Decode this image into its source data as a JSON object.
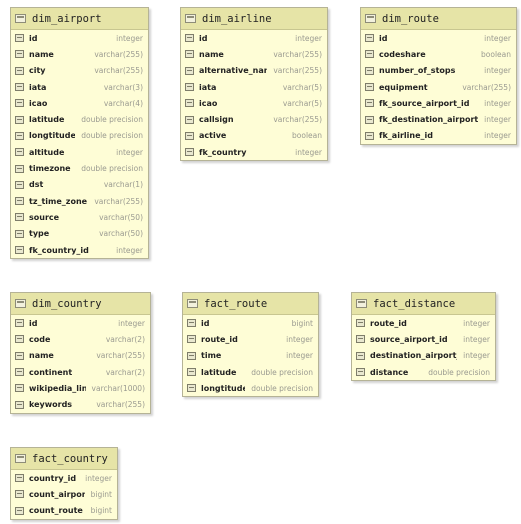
{
  "tables": [
    {
      "id": "dim-airport",
      "name": "dim_airport",
      "columns": [
        {
          "name": "id",
          "type": "integer"
        },
        {
          "name": "name",
          "type": "varchar(255)"
        },
        {
          "name": "city",
          "type": "varchar(255)"
        },
        {
          "name": "iata",
          "type": "varchar(3)"
        },
        {
          "name": "icao",
          "type": "varchar(4)"
        },
        {
          "name": "latitude",
          "type": "double precision"
        },
        {
          "name": "longtitude",
          "type": "double precision"
        },
        {
          "name": "altitude",
          "type": "integer"
        },
        {
          "name": "timezone",
          "type": "double precision"
        },
        {
          "name": "dst",
          "type": "varchar(1)"
        },
        {
          "name": "tz_time_zone",
          "type": "varchar(255)"
        },
        {
          "name": "source",
          "type": "varchar(50)"
        },
        {
          "name": "type",
          "type": "varchar(50)"
        },
        {
          "name": "fk_country_id",
          "type": "integer"
        }
      ]
    },
    {
      "id": "dim-airline",
      "name": "dim_airline",
      "columns": [
        {
          "name": "id",
          "type": "integer"
        },
        {
          "name": "name",
          "type": "varchar(255)"
        },
        {
          "name": "alternative_name",
          "type": "varchar(255)"
        },
        {
          "name": "iata",
          "type": "varchar(5)"
        },
        {
          "name": "icao",
          "type": "varchar(5)"
        },
        {
          "name": "callsign",
          "type": "varchar(255)"
        },
        {
          "name": "active",
          "type": "boolean"
        },
        {
          "name": "fk_country",
          "type": "integer"
        }
      ]
    },
    {
      "id": "dim-route",
      "name": "dim_route",
      "columns": [
        {
          "name": "id",
          "type": "integer"
        },
        {
          "name": "codeshare",
          "type": "boolean"
        },
        {
          "name": "number_of_stops",
          "type": "integer"
        },
        {
          "name": "equipment",
          "type": "varchar(255)"
        },
        {
          "name": "fk_source_airport_id",
          "type": "integer"
        },
        {
          "name": "fk_destination_airport_id",
          "type": "integer"
        },
        {
          "name": "fk_airline_id",
          "type": "integer"
        }
      ]
    },
    {
      "id": "dim-country",
      "name": "dim_country",
      "columns": [
        {
          "name": "id",
          "type": "integer"
        },
        {
          "name": "code",
          "type": "varchar(2)"
        },
        {
          "name": "name",
          "type": "varchar(255)"
        },
        {
          "name": "continent",
          "type": "varchar(2)"
        },
        {
          "name": "wikipedia_link",
          "type": "varchar(1000)"
        },
        {
          "name": "keywords",
          "type": "varchar(255)"
        }
      ]
    },
    {
      "id": "fact-route",
      "name": "fact_route",
      "columns": [
        {
          "name": "id",
          "type": "bigint"
        },
        {
          "name": "route_id",
          "type": "integer"
        },
        {
          "name": "time",
          "type": "integer"
        },
        {
          "name": "latitude",
          "type": "double precision"
        },
        {
          "name": "longtitude",
          "type": "double precision"
        }
      ]
    },
    {
      "id": "fact-distance",
      "name": "fact_distance",
      "columns": [
        {
          "name": "route_id",
          "type": "integer"
        },
        {
          "name": "source_airport_id",
          "type": "integer"
        },
        {
          "name": "destination_airport_id",
          "type": "integer"
        },
        {
          "name": "distance",
          "type": "double precision"
        }
      ]
    },
    {
      "id": "fact-country",
      "name": "fact_country",
      "columns": [
        {
          "name": "country_id",
          "type": "integer"
        },
        {
          "name": "count_airport",
          "type": "bigint"
        },
        {
          "name": "count_route",
          "type": "bigint"
        }
      ]
    }
  ]
}
